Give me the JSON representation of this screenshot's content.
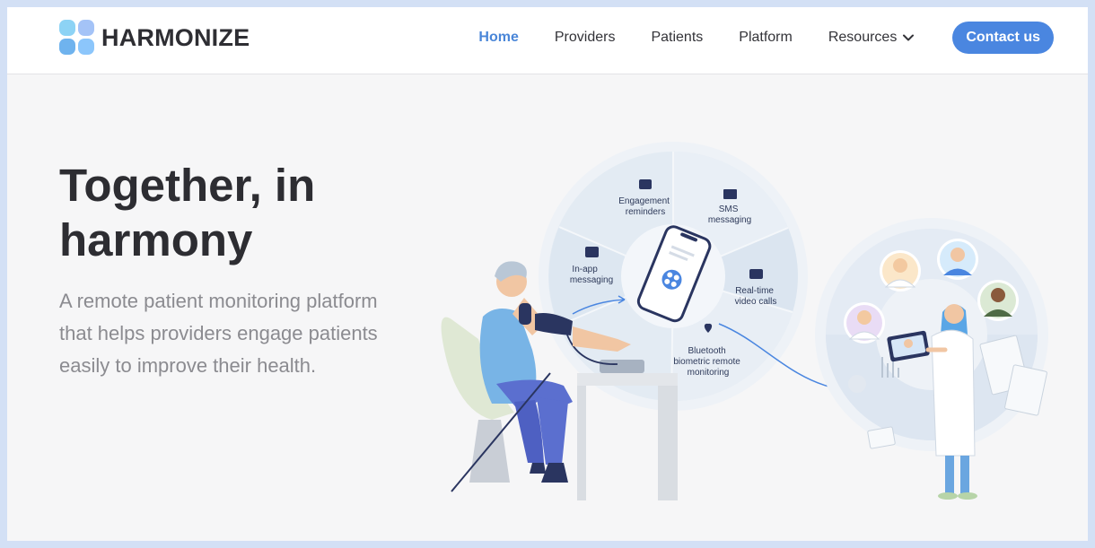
{
  "brand": {
    "name": "HARMONIZE",
    "colors": [
      "#8dd3f5",
      "#a4c3f7",
      "#6fb3ee",
      "#8cc6fb"
    ]
  },
  "nav": {
    "items": [
      {
        "label": "Home",
        "active": true
      },
      {
        "label": "Providers",
        "active": false
      },
      {
        "label": "Patients",
        "active": false
      },
      {
        "label": "Platform",
        "active": false
      },
      {
        "label": "Resources",
        "active": false,
        "dropdown": true
      }
    ],
    "cta": "Contact us"
  },
  "hero": {
    "title": "Together, in harmony",
    "subtitle": "A remote patient monitoring platform that helps providers engage patients easily to improve their health."
  },
  "illustration": {
    "wheel_labels": {
      "engagement": [
        "Engagement",
        "reminders"
      ],
      "sms": [
        "SMS",
        "messaging"
      ],
      "inapp": [
        "In-app",
        "messaging"
      ],
      "video": [
        "Real-time",
        "video calls"
      ],
      "bluetooth": [
        "Bluetooth",
        "biometric remote",
        "monitoring"
      ]
    },
    "colors": {
      "accent": "#4a86e0",
      "wheel": "#e3ebf3",
      "wheel_dark": "#d0dde9",
      "navy": "#2a3560"
    }
  }
}
